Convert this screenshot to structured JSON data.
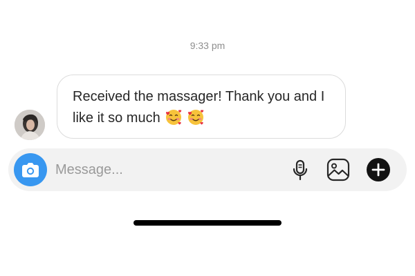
{
  "thread": {
    "timestamp": "9:33 pm",
    "message": {
      "text": "Received the massager! Thank you and I like it so much",
      "emojis": [
        "smiling-face-with-hearts",
        "smiling-face-with-hearts"
      ]
    }
  },
  "composer": {
    "placeholder": "Message...",
    "camera_icon": "camera-icon",
    "mic_icon": "microphone-icon",
    "gallery_icon": "image-icon",
    "add_icon": "plus-circle-icon",
    "accent_color": "#3897f0"
  }
}
